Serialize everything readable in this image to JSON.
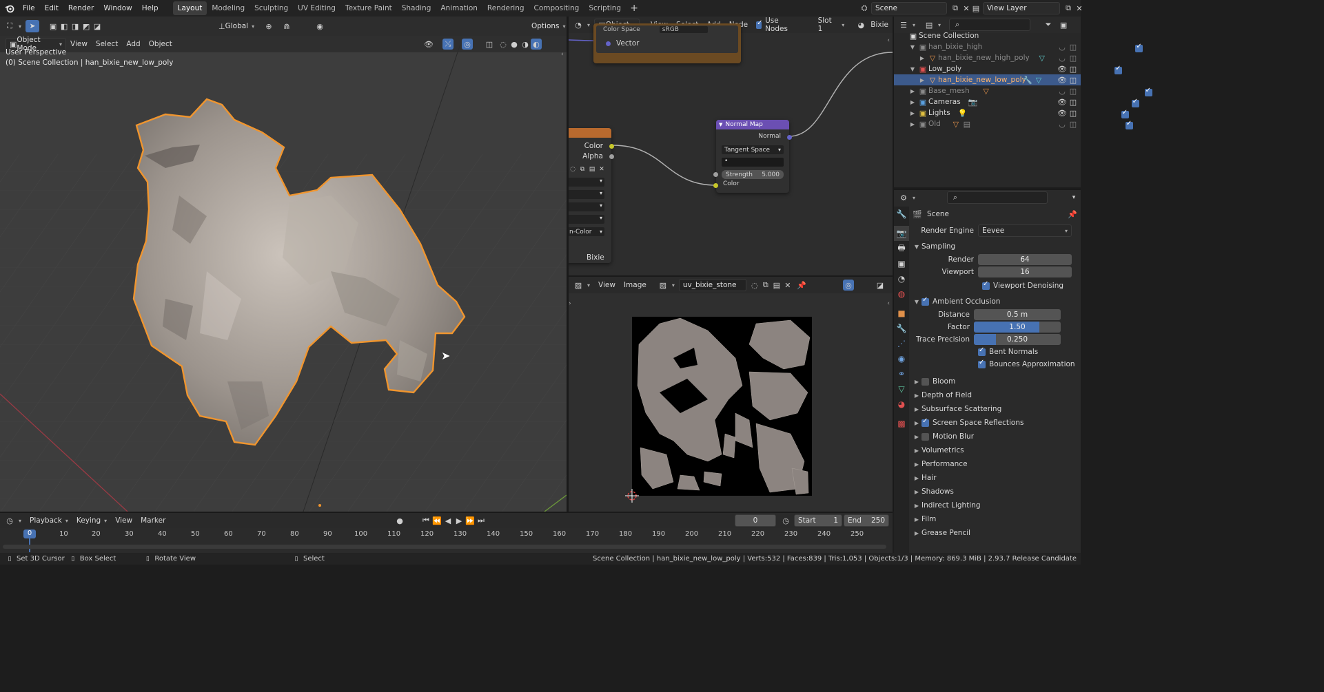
{
  "topbar": {
    "menus": [
      "File",
      "Edit",
      "Render",
      "Window",
      "Help"
    ],
    "workspaces": [
      "Layout",
      "Modeling",
      "Sculpting",
      "UV Editing",
      "Texture Paint",
      "Shading",
      "Animation",
      "Rendering",
      "Compositing",
      "Scripting"
    ],
    "active_workspace": "Layout",
    "scene": "Scene",
    "view_layer": "View Layer"
  },
  "viewport": {
    "mode": "Object Mode",
    "menus": [
      "View",
      "Select",
      "Add",
      "Object"
    ],
    "transform": "Global",
    "options": "Options",
    "perspective_label": "User Perspective",
    "collection_label": "(0) Scene Collection | han_bixie_new_low_poly"
  },
  "node_editor": {
    "object_type": "Object",
    "menus": [
      "View",
      "Select",
      "Add",
      "Node"
    ],
    "use_nodes_label": "Use Nodes",
    "slot": "Slot 1",
    "material": "Bixie",
    "upper_node_socket": "Vector",
    "upper_node_cut_label": "Color Space",
    "upper_node_cut_value": "sRGB",
    "image_node_outputs": [
      "Color",
      "Alpha"
    ],
    "image_node_partial_value": "n-Color",
    "image_node_footer": "Bixie",
    "normal_map": {
      "title": "Normal Map",
      "output": "Normal",
      "space": "Tangent Space",
      "uv_field": "•",
      "strength_label": "Strength",
      "strength_value": "5.000",
      "input": "Color"
    }
  },
  "image_editor": {
    "menus": [
      "View",
      "Image"
    ],
    "image_name": "uv_bixie_stone"
  },
  "outliner": {
    "root": "Scene Collection",
    "rows": [
      {
        "label": "han_bixie_high",
        "indent": 1,
        "dim": true,
        "type": "collection"
      },
      {
        "label": "han_bixie_new_high_poly",
        "indent": 2,
        "dim": true,
        "type": "mesh"
      },
      {
        "label": "Low_poly",
        "indent": 1,
        "dim": false,
        "type": "collection"
      },
      {
        "label": "han_bixie_new_low_poly",
        "indent": 2,
        "dim": false,
        "type": "mesh",
        "selected": true
      },
      {
        "label": "Base_mesh",
        "indent": 1,
        "dim": true,
        "type": "collection"
      },
      {
        "label": "Cameras",
        "indent": 1,
        "dim": false,
        "type": "collection"
      },
      {
        "label": "Lights",
        "indent": 1,
        "dim": false,
        "type": "collection"
      },
      {
        "label": "Old",
        "indent": 1,
        "dim": true,
        "type": "collection"
      }
    ]
  },
  "properties": {
    "context": "Scene",
    "render_engine_label": "Render Engine",
    "render_engine": "Eevee",
    "sampling": {
      "title": "Sampling",
      "render_label": "Render",
      "render": "64",
      "viewport_label": "Viewport",
      "viewport": "16",
      "denoise_label": "Viewport Denoising"
    },
    "ao": {
      "title": "Ambient Occlusion",
      "distance_label": "Distance",
      "distance": "0.5 m",
      "factor_label": "Factor",
      "factor": "1.50",
      "factor_fill": 0.75,
      "trace_label": "Trace Precision",
      "trace": "0.250",
      "trace_fill": 0.25,
      "bent_label": "Bent Normals",
      "bounce_label": "Bounces Approximation"
    },
    "sections": [
      {
        "label": "Bloom",
        "check": false
      },
      {
        "label": "Depth of Field"
      },
      {
        "label": "Subsurface Scattering"
      },
      {
        "label": "Screen Space Reflections",
        "check": true
      },
      {
        "label": "Motion Blur",
        "check": false
      },
      {
        "label": "Volumetrics"
      },
      {
        "label": "Performance"
      },
      {
        "label": "Hair"
      },
      {
        "label": "Shadows"
      },
      {
        "label": "Indirect Lighting"
      },
      {
        "label": "Film"
      },
      {
        "label": "Grease Pencil"
      }
    ]
  },
  "timeline": {
    "menus": [
      "Playback",
      "Keying",
      "View",
      "Marker"
    ],
    "current_frame": "0",
    "start_label": "Start",
    "start": "1",
    "end_label": "End",
    "end": "250",
    "ticks": [
      "0",
      "10",
      "20",
      "30",
      "40",
      "50",
      "60",
      "70",
      "80",
      "90",
      "100",
      "110",
      "120",
      "130",
      "140",
      "150",
      "160",
      "170",
      "180",
      "190",
      "200",
      "210",
      "220",
      "230",
      "240",
      "250"
    ]
  },
  "statusbar": {
    "hints": [
      "Set 3D Cursor",
      "Box Select",
      "Rotate View",
      "Select"
    ],
    "info": "Scene Collection | han_bixie_new_low_poly | Verts:532 | Faces:839 | Tris:1,053 | Objects:1/3 | Memory: 869.3 MiB | 2.93.7 Release Candidate"
  },
  "colors": {
    "accent": "#4772b3",
    "selection_outline": "#f0952e",
    "normal_map_header": "#6b4fb3",
    "image_node_header": "#b96a2e"
  }
}
